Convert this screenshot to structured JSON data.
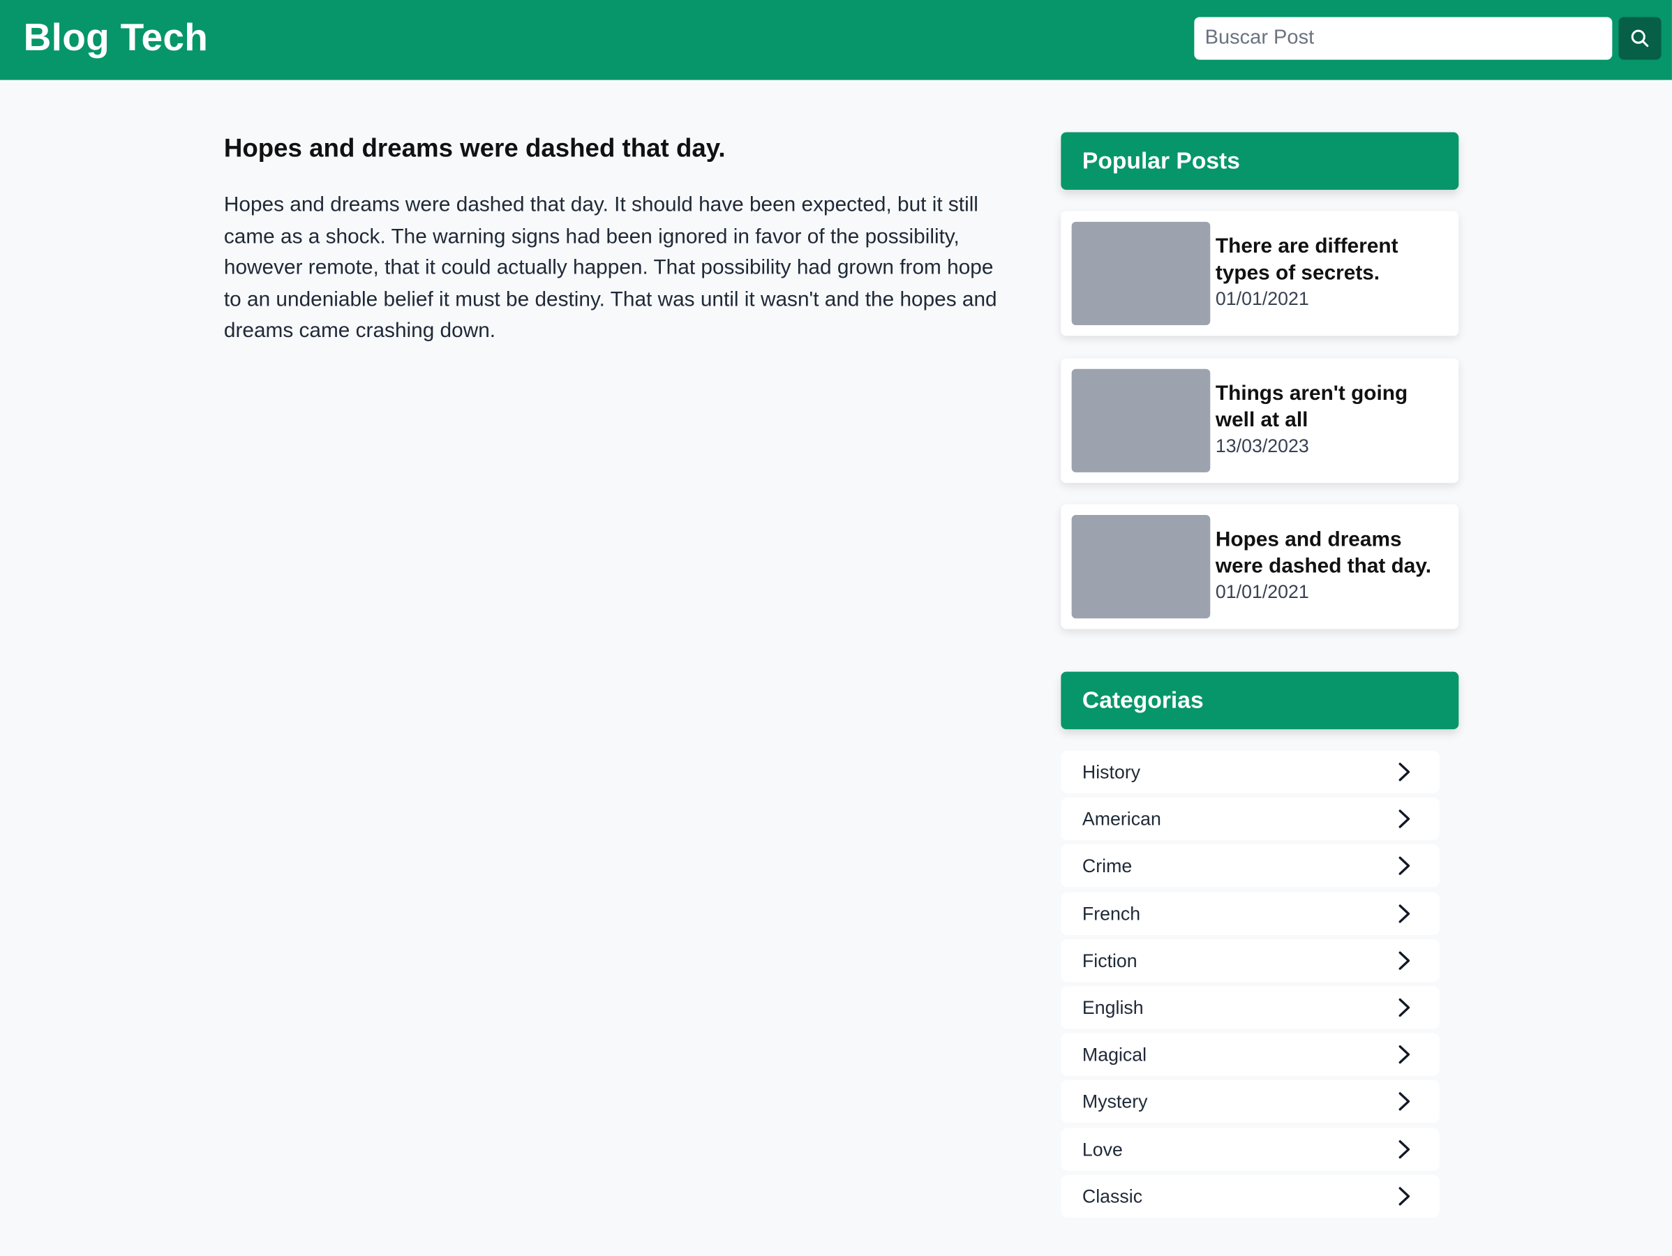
{
  "header": {
    "brand": "Blog Tech",
    "search_placeholder": "Buscar Post",
    "search_value": ""
  },
  "article": {
    "title": "Hopes and dreams were dashed that day.",
    "body": "Hopes and dreams were dashed that day. It should have been expected, but it still came as a shock. The warning signs had been ignored in favor of the possibility, however remote, that it could actually happen. That possibility had grown from hope to an undeniable belief it must be destiny. That was until it wasn't and the hopes and dreams came crashing down."
  },
  "sidebar": {
    "popular_title": "Popular Posts",
    "popular_posts": [
      {
        "title": "There are different types of secrets.",
        "date": "01/01/2021"
      },
      {
        "title": "Things aren't going well at all",
        "date": "13/03/2023"
      },
      {
        "title": "Hopes and dreams were dashed that day.",
        "date": "01/01/2021"
      }
    ],
    "categories_title": "Categorias",
    "categories": [
      {
        "label": "History"
      },
      {
        "label": "American"
      },
      {
        "label": "Crime"
      },
      {
        "label": "French"
      },
      {
        "label": "Fiction"
      },
      {
        "label": "English"
      },
      {
        "label": "Magical"
      },
      {
        "label": "Mystery"
      },
      {
        "label": "Love"
      },
      {
        "label": "Classic"
      }
    ]
  },
  "icons": {
    "search": "search-icon",
    "category_arrow": "chevron-right-icon"
  },
  "colors": {
    "brand": "#069669",
    "brand_dark": "#065f46",
    "thumb": "#9ca3af",
    "page_bg": "#f8f9fb"
  }
}
